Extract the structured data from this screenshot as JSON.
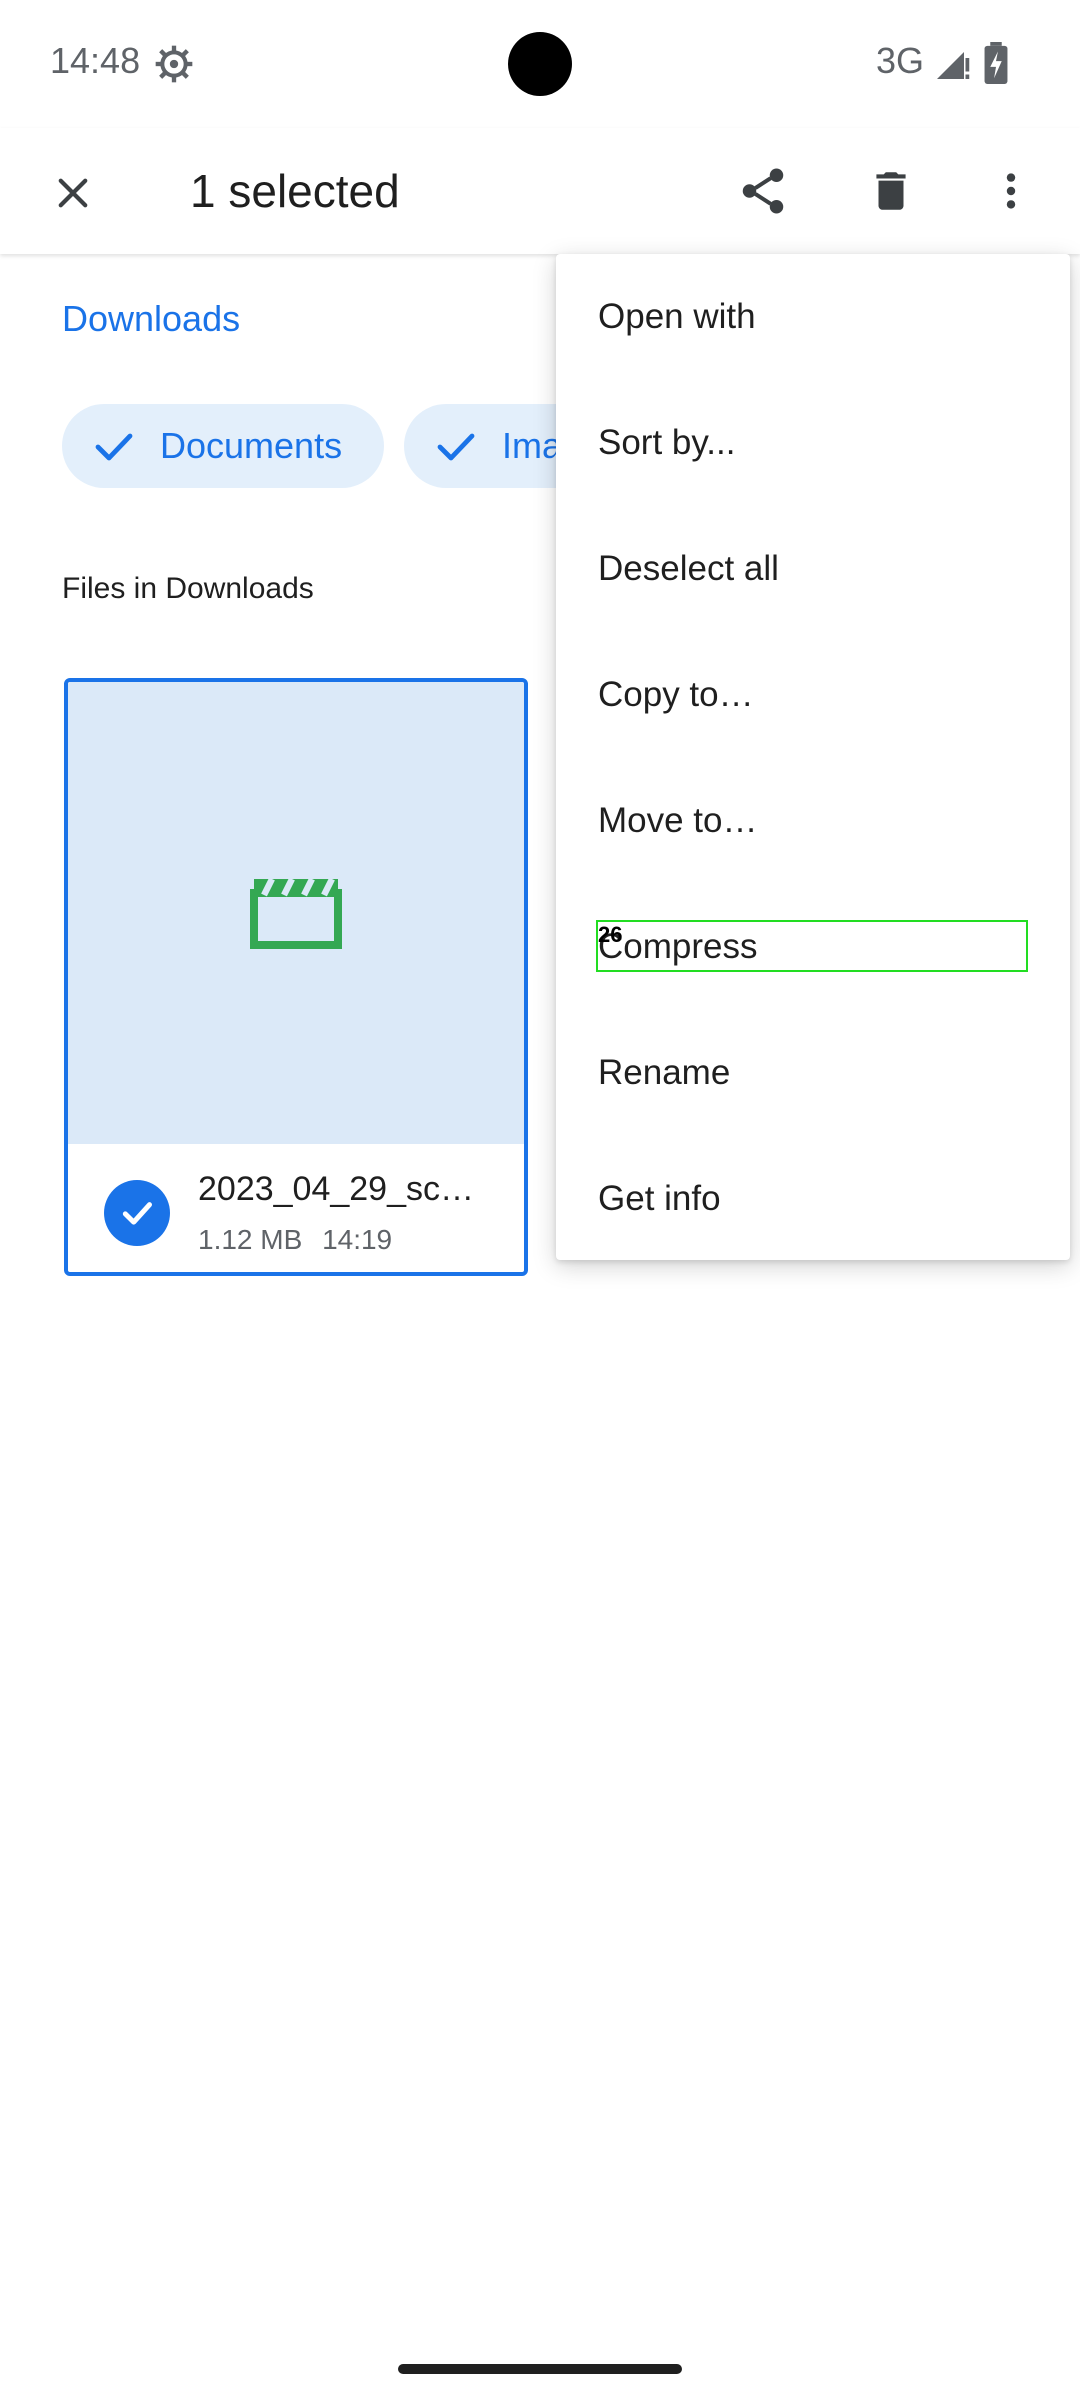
{
  "status_bar": {
    "time": "14:48",
    "network": "3G"
  },
  "app_bar": {
    "title": "1 selected"
  },
  "breadcrumb": "Downloads",
  "chips": [
    {
      "label": "Documents"
    },
    {
      "label": "Ima"
    }
  ],
  "section_title": "Files in Downloads",
  "file": {
    "name": "2023_04_29_sc…",
    "size": "1.12 MB",
    "time": "14:19"
  },
  "menu": {
    "items": [
      {
        "label": "Open with"
      },
      {
        "label": "Sort by..."
      },
      {
        "label": "Deselect all"
      },
      {
        "label": "Copy to…"
      },
      {
        "label": "Move to…"
      },
      {
        "label": "Compress"
      },
      {
        "label": "Rename"
      },
      {
        "label": "Get info"
      }
    ]
  },
  "highlight": {
    "number": "26"
  },
  "colors": {
    "accent": "#1a73e8",
    "chip_bg": "#e3effb",
    "thumb_bg": "#dbe9f8",
    "video_icon": "#34a853"
  }
}
